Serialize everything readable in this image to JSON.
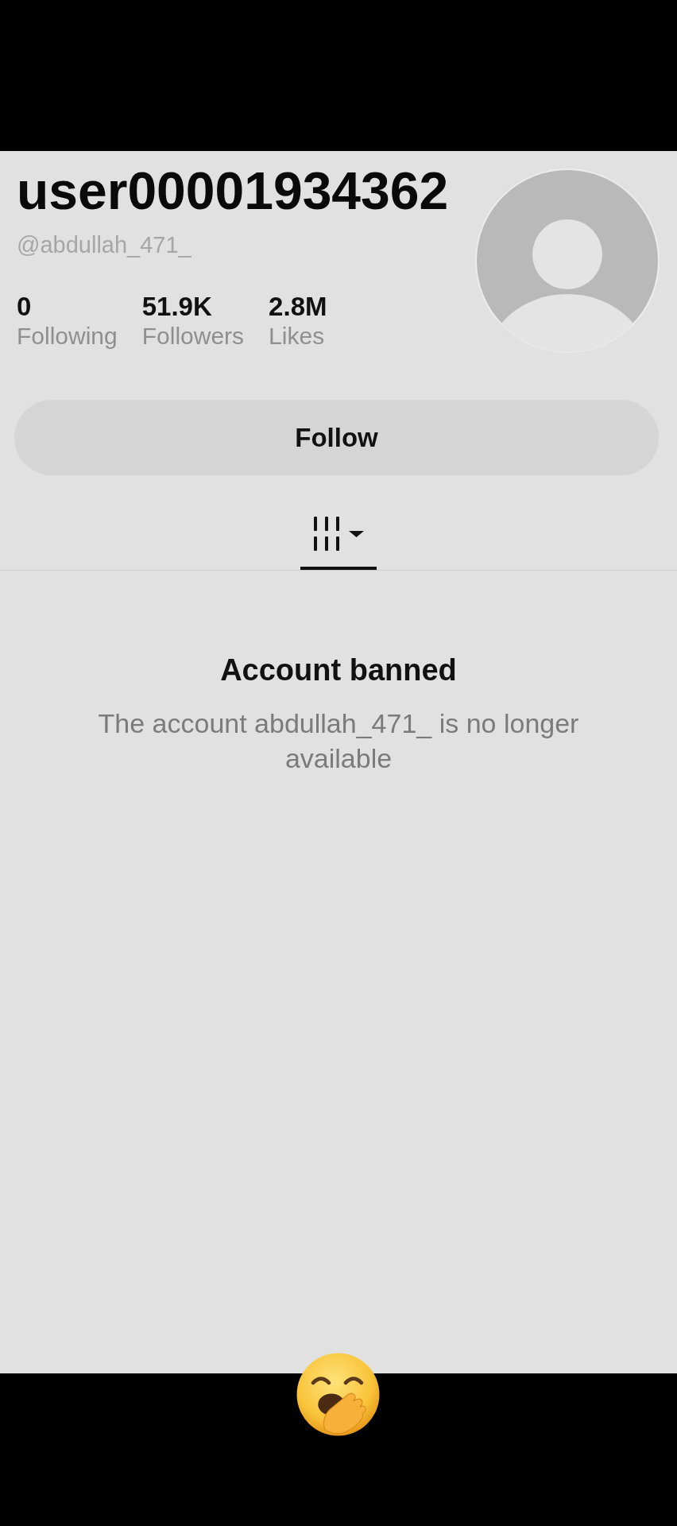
{
  "profile": {
    "display_name": "user00001934362",
    "handle": "@abdullah_471_",
    "stats": [
      {
        "value": "0",
        "label": "Following"
      },
      {
        "value": "51.9K",
        "label": "Followers"
      },
      {
        "value": "2.8M",
        "label": "Likes"
      }
    ]
  },
  "follow_button": {
    "label": "Follow"
  },
  "tabs": [
    {
      "selected": true
    }
  ],
  "notice": {
    "title": "Account banned",
    "message": "The account abdullah_471_ is no longer available"
  }
}
